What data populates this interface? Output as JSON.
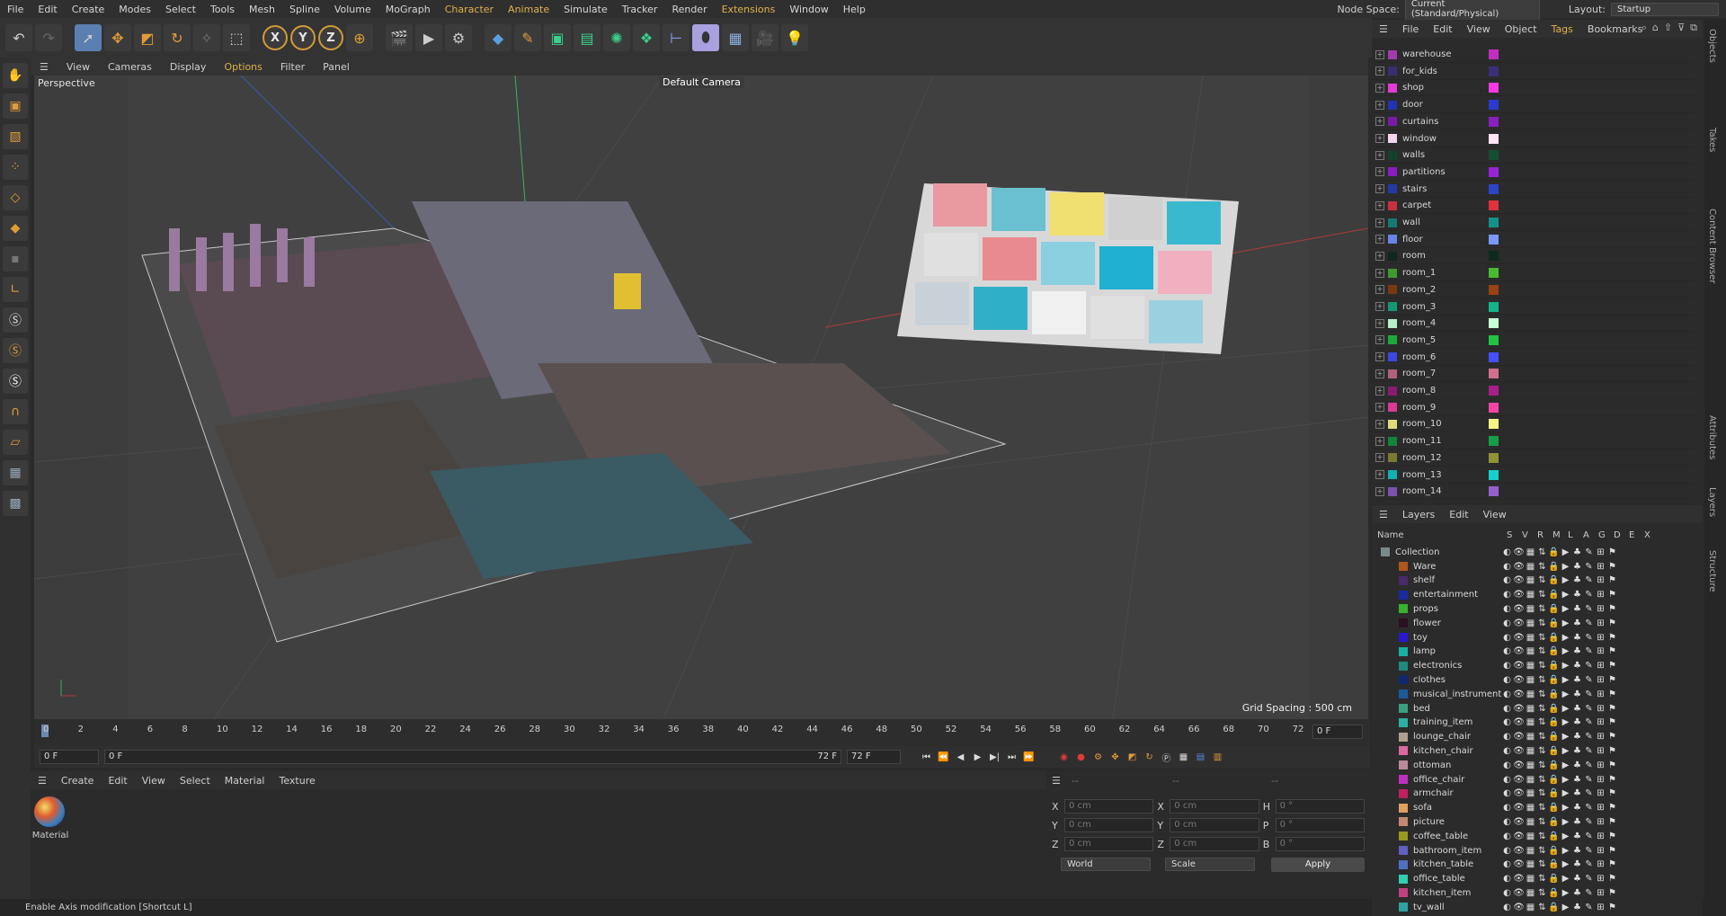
{
  "menubar": {
    "items": [
      "File",
      "Edit",
      "Create",
      "Modes",
      "Select",
      "Tools",
      "Mesh",
      "Spline",
      "Volume",
      "MoGraph",
      "Character",
      "Animate",
      "Simulate",
      "Tracker",
      "Render",
      "Extensions",
      "Window",
      "Help"
    ],
    "node_space_label": "Node Space:",
    "node_space_value": "Current (Standard/Physical)",
    "layout_label": "Layout:",
    "layout_value": "Startup"
  },
  "toolbar": {
    "axis_x": "X",
    "axis_y": "Y",
    "axis_z": "Z"
  },
  "viewport": {
    "menu": [
      "View",
      "Cameras",
      "Display",
      "Options",
      "Filter",
      "Panel"
    ],
    "label": "Perspective",
    "camera": "Default Camera",
    "grid_spacing": "Grid Spacing : 500 cm"
  },
  "timeline": {
    "ticks": [
      "0",
      "2",
      "4",
      "6",
      "8",
      "10",
      "12",
      "14",
      "16",
      "18",
      "20",
      "22",
      "24",
      "26",
      "28",
      "30",
      "32",
      "34",
      "36",
      "38",
      "40",
      "42",
      "44",
      "46",
      "48",
      "50",
      "52",
      "54",
      "56",
      "58",
      "60",
      "62",
      "64",
      "66",
      "68",
      "70",
      "72"
    ],
    "current_frame": "0 F",
    "start_field": "0 F",
    "range_start": "0 F",
    "range_end": "72 F",
    "end_field": "72 F"
  },
  "material": {
    "menu": [
      "Create",
      "Edit",
      "View",
      "Select",
      "Material",
      "Texture"
    ],
    "name": "Material"
  },
  "coords": {
    "rows": [
      {
        "a": "X",
        "av": "0 cm",
        "b": "X",
        "bv": "0 cm",
        "c": "H",
        "cv": "0 °"
      },
      {
        "a": "Y",
        "av": "0 cm",
        "b": "Y",
        "bv": "0 cm",
        "c": "P",
        "cv": "0 °"
      },
      {
        "a": "Z",
        "av": "0 cm",
        "b": "Z",
        "bv": "0 cm",
        "c": "B",
        "cv": "0 °"
      }
    ],
    "mode": "World",
    "scale": "Scale",
    "apply": "Apply",
    "dash": "--"
  },
  "objects": {
    "menu": [
      "File",
      "Edit",
      "View",
      "Object",
      "Tags",
      "Bookmarks"
    ],
    "items": [
      {
        "name": "warehouse",
        "color": "#a23bb0",
        "tag": "#c02ec0"
      },
      {
        "name": "for_kids",
        "color": "#3a2f6e",
        "tag": "#3a2f7a"
      },
      {
        "name": "shop",
        "color": "#e23bd8",
        "tag": "#ff37e6"
      },
      {
        "name": "door",
        "color": "#2232b4",
        "tag": "#2a3ad0"
      },
      {
        "name": "curtains",
        "color": "#7a1aa6",
        "tag": "#8a1fc0"
      },
      {
        "name": "window",
        "color": "#f3d4ea",
        "tag": "#ffe4f4"
      },
      {
        "name": "walls",
        "color": "#15402e",
        "tag": "#135033"
      },
      {
        "name": "partitions",
        "color": "#8a1cc0",
        "tag": "#9a22d8"
      },
      {
        "name": "stairs",
        "color": "#233aa6",
        "tag": "#2a46c8"
      },
      {
        "name": "carpet",
        "color": "#c9303e",
        "tag": "#e0303e"
      },
      {
        "name": "wall",
        "color": "#147a72",
        "tag": "#12928a"
      },
      {
        "name": "floor",
        "color": "#6884e6",
        "tag": "#7a98ff"
      },
      {
        "name": "room",
        "color": "#10281c",
        "tag": "#0d2a1c"
      },
      {
        "name": "room_1",
        "color": "#3f9a2e",
        "tag": "#4aba32"
      },
      {
        "name": "room_2",
        "color": "#7a3810",
        "tag": "#9a4210"
      },
      {
        "name": "room_3",
        "color": "#149874",
        "tag": "#14b488"
      },
      {
        "name": "room_4",
        "color": "#b6f0c4",
        "tag": "#c8ffd6"
      },
      {
        "name": "room_5",
        "color": "#1ea83a",
        "tag": "#22c442"
      },
      {
        "name": "room_6",
        "color": "#3d46e0",
        "tag": "#4450ff"
      },
      {
        "name": "room_7",
        "color": "#b2607c",
        "tag": "#d0708e"
      },
      {
        "name": "room_8",
        "color": "#8a1a72",
        "tag": "#a81e8a"
      },
      {
        "name": "room_9",
        "color": "#d83a96",
        "tag": "#f844a8"
      },
      {
        "name": "room_10",
        "color": "#dedc7a",
        "tag": "#f6f484"
      },
      {
        "name": "room_11",
        "color": "#12843c",
        "tag": "#14a046"
      },
      {
        "name": "room_12",
        "color": "#7a7a30",
        "tag": "#929236"
      },
      {
        "name": "room_13",
        "color": "#12b0b0",
        "tag": "#14d0d0"
      },
      {
        "name": "room_14",
        "color": "#7c52b0",
        "tag": "#9460d0"
      }
    ]
  },
  "layers": {
    "menu": [
      "Layers",
      "Edit",
      "View"
    ],
    "headers": [
      "Name",
      "S",
      "V",
      "R",
      "M",
      "L",
      "A",
      "G",
      "D",
      "E",
      "X"
    ],
    "root": "Collection",
    "items": [
      {
        "name": "Ware",
        "color": "#b0561e"
      },
      {
        "name": "shelf",
        "color": "#4a2a6a"
      },
      {
        "name": "entertainment",
        "color": "#1a2aa0"
      },
      {
        "name": "props",
        "color": "#3ab030"
      },
      {
        "name": "flower",
        "color": "#2a1020"
      },
      {
        "name": "toy",
        "color": "#2a18d0"
      },
      {
        "name": "lamp",
        "color": "#18b0a0"
      },
      {
        "name": "electronics",
        "color": "#208a80"
      },
      {
        "name": "clothes",
        "color": "#0f2a70"
      },
      {
        "name": "musical_instrument",
        "color": "#1c5a9a"
      },
      {
        "name": "bed",
        "color": "#3aa080"
      },
      {
        "name": "training_item",
        "color": "#2ab0a0"
      },
      {
        "name": "lounge_chair",
        "color": "#b0a090"
      },
      {
        "name": "kitchen_chair",
        "color": "#d86aa0"
      },
      {
        "name": "ottoman",
        "color": "#b88a9a"
      },
      {
        "name": "office_chair",
        "color": "#c030c0"
      },
      {
        "name": "armchair",
        "color": "#c02060"
      },
      {
        "name": "sofa",
        "color": "#e0a060"
      },
      {
        "name": "picture",
        "color": "#c08a70"
      },
      {
        "name": "coffee_table",
        "color": "#9a9a20"
      },
      {
        "name": "bathroom_item",
        "color": "#6060c0"
      },
      {
        "name": "kitchen_table",
        "color": "#5070c0"
      },
      {
        "name": "office_table",
        "color": "#30d0b0"
      },
      {
        "name": "kitchen_item",
        "color": "#c04080"
      },
      {
        "name": "tv_wall",
        "color": "#30a0a0"
      }
    ]
  },
  "right_strip": [
    "Objects",
    "Takes",
    "Content Browser",
    "Attributes",
    "Layers",
    "Structure"
  ],
  "status": "Enable Axis modification [Shortcut L]"
}
